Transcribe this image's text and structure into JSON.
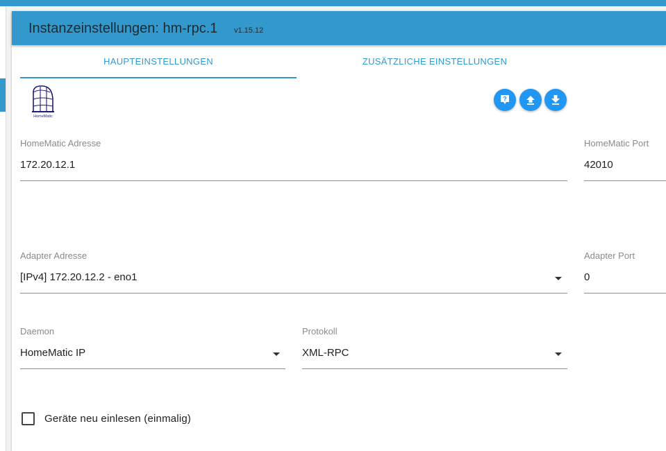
{
  "header": {
    "title": "Instanzeinstellungen: hm-rpc.1",
    "version": "v1.15.12"
  },
  "tabs": [
    {
      "label": "HAUPTEINSTELLUNGEN",
      "active": true
    },
    {
      "label": "ZUSÄTZLICHE EINSTELLUNGEN",
      "active": false
    }
  ],
  "logo": {
    "text": "HomeMatic"
  },
  "toolbar": {
    "help_icon": "help-icon",
    "upload_icon": "upload-icon",
    "download_icon": "download-icon"
  },
  "fields": {
    "homematic_address": {
      "label": "HomeMatic Adresse",
      "value": "172.20.12.1"
    },
    "homematic_port": {
      "label": "HomeMatic Port",
      "value": "42010"
    },
    "adapter_address": {
      "label": "Adapter Adresse",
      "value": "[IPv4] 172.20.12.2 - eno1"
    },
    "adapter_port": {
      "label": "Adapter Port",
      "value": "0"
    },
    "daemon": {
      "label": "Daemon",
      "value": "HomeMatic IP"
    },
    "protocol": {
      "label": "Protokoll",
      "value": "XML-RPC"
    }
  },
  "checkbox": {
    "label": "Geräte neu einlesen (einmalig)",
    "checked": false
  },
  "colors": {
    "accent": "#3399cc",
    "button": "#2196f3",
    "label": "#8a8a8a"
  }
}
